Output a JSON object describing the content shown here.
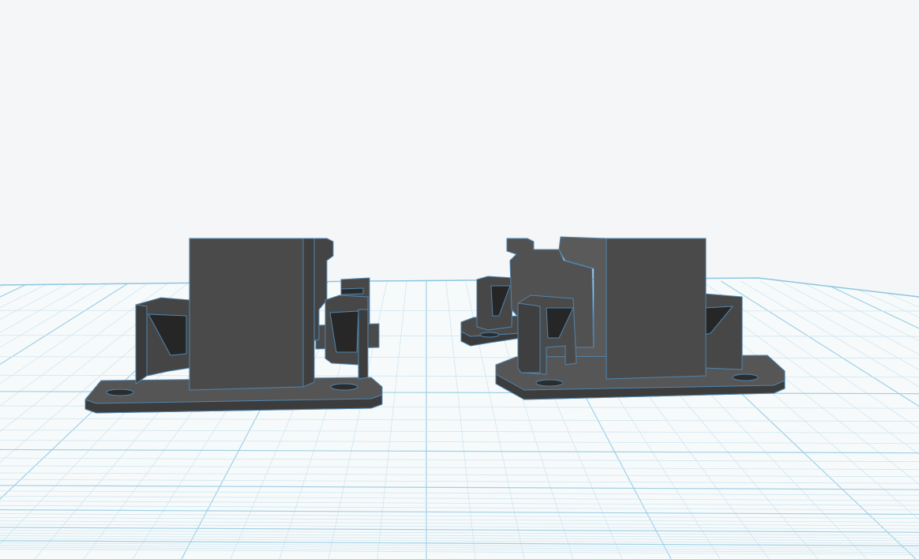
{
  "scene": {
    "view": "3d-workplane",
    "objects": [
      {
        "name": "mount-bracket-left"
      },
      {
        "name": "mount-bracket-right"
      }
    ]
  },
  "colors": {
    "background": "#f4f6f7",
    "grid_minor": "#cfe6f1",
    "grid_major": "#9fd0e6",
    "model_top": "#4b4b4b",
    "model_face": "#3e3e3e",
    "model_dark": "#2a2a2a",
    "model_edge": "#4f86b0"
  }
}
